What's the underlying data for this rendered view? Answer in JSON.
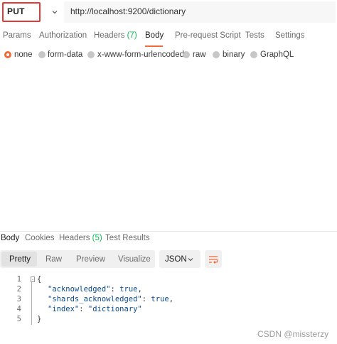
{
  "request": {
    "method": "PUT",
    "url": "http://localhost:9200/dictionary",
    "tabs": [
      {
        "label": "Params"
      },
      {
        "label": "Authorization"
      },
      {
        "label": "Headers",
        "count": "(7)"
      },
      {
        "label": "Body"
      },
      {
        "label": "Pre-request Script"
      },
      {
        "label": "Tests"
      },
      {
        "label": "Settings"
      }
    ],
    "active_tab": "Body",
    "body_modes": [
      "none",
      "form-data",
      "x-www-form-urlencoded",
      "raw",
      "binary",
      "GraphQL"
    ],
    "selected_body_mode": "none"
  },
  "response": {
    "tabs": [
      {
        "label": "Body"
      },
      {
        "label": "Cookies"
      },
      {
        "label": "Headers",
        "count": "(5)"
      },
      {
        "label": "Test Results"
      }
    ],
    "active_tab": "Body",
    "view_modes": [
      "Pretty",
      "Raw",
      "Preview",
      "Visualize"
    ],
    "active_view": "Pretty",
    "format": "JSON",
    "code_lines": [
      {
        "n": "1",
        "text": "{"
      },
      {
        "n": "2",
        "key": "\"acknowledged\"",
        "sep": ": ",
        "value": "true",
        "end": ","
      },
      {
        "n": "3",
        "key": "\"shards_acknowledged\"",
        "sep": ": ",
        "value": "true",
        "end": ","
      },
      {
        "n": "4",
        "key": "\"index\"",
        "sep": ": ",
        "value": "\"dictionary\"",
        "end": ""
      },
      {
        "n": "5",
        "text": "}"
      }
    ]
  },
  "watermark": "CSDN @missterzy",
  "colors": {
    "accent": "#f26b3a",
    "highlight": "#e53935",
    "count": "#0cbb52"
  }
}
